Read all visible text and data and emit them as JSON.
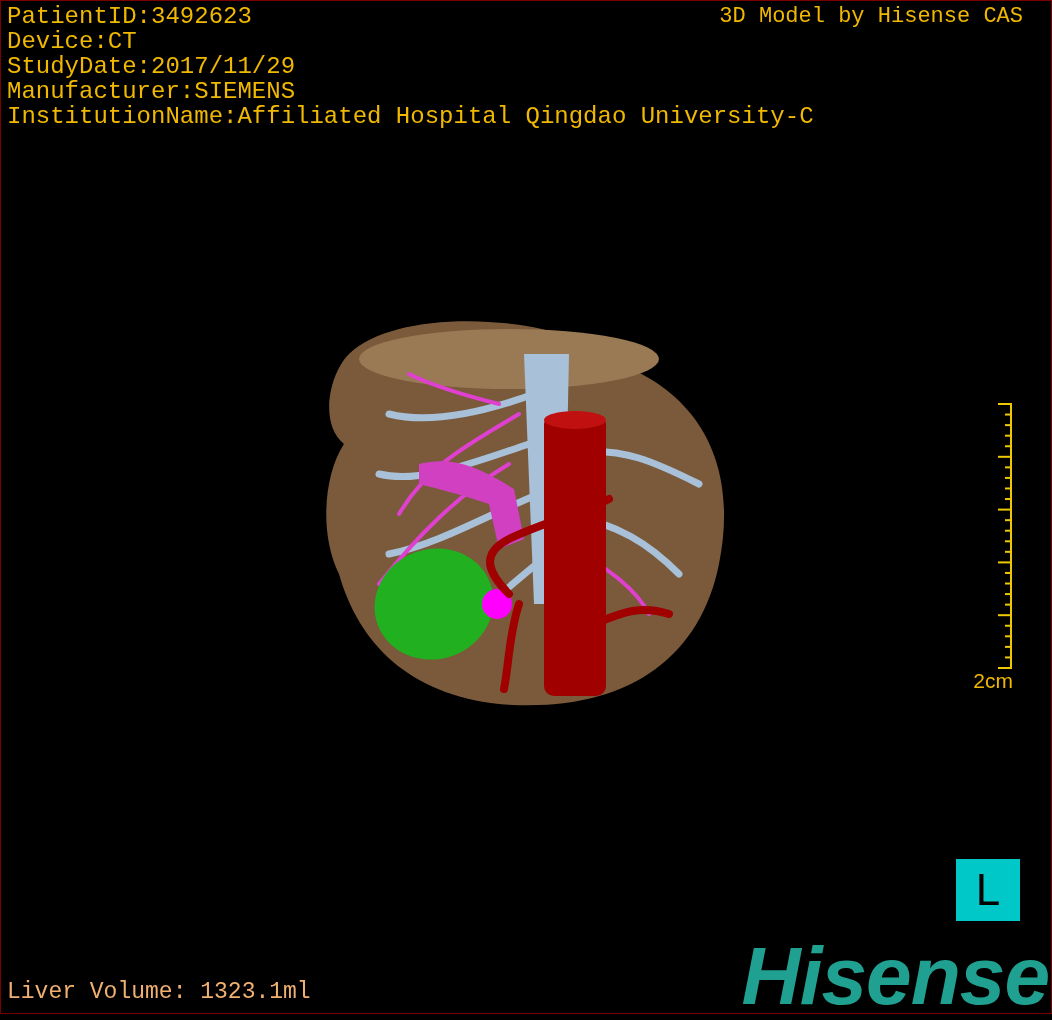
{
  "study_info": [
    "PatientID:3492623",
    "Device:CT",
    "StudyDate:2017/11/29",
    "Manufacturer:SIEMENS",
    "InstitutionName:Affiliated Hospital Qingdao University-C"
  ],
  "credit": "3D Model by Hisense CAS",
  "scale": {
    "label": "2cm"
  },
  "orientation": "L",
  "liver_volume": "Liver Volume: 1323.1ml",
  "logo": "Hisense"
}
